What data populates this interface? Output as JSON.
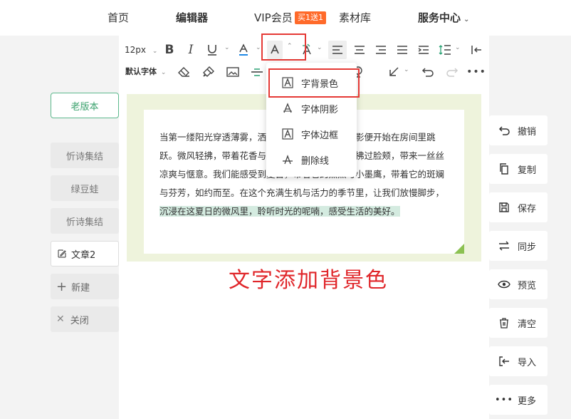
{
  "nav": {
    "home": "首页",
    "editor": "编辑器",
    "vip": "VIP会员",
    "vip_badge": "买1送1",
    "materials": "素材库",
    "service": "服务中心"
  },
  "toolbar": {
    "font_size": "12px",
    "font_family": "默认字体"
  },
  "dropdown": {
    "items": [
      "字背景色",
      "字体阴影",
      "字体边框",
      "删除线"
    ]
  },
  "content": {
    "text_plain": "当第一缕阳光穿透薄雾，洒落在大地上，夏日的光影便开始在房间里跳跃。微风轻拂，带着花香与草香，悄悄溜进窗棂，拂过脸颊，带来一丝丝凉爽与惬意。我们能感受到夏日，带着它的热烈与小墨鹰，带着它的斑斓与芬芳，如约而至。在这个充满生机与活力的季节里，让我们放慢脚步，",
    "text_highlighted": "沉浸在这夏日的微风里，聆听时光的呢喃，感受生活的美好。"
  },
  "caption": "文字添加背景色",
  "left_sidebar": {
    "old_version": "老版本",
    "items": [
      "忻诗集结",
      "绿豆蛙",
      "忻诗集结"
    ],
    "active": "文章2",
    "new": "新建",
    "close": "关闭"
  },
  "right_sidebar": {
    "items": [
      "撤销",
      "复制",
      "保存",
      "同步",
      "预览",
      "清空",
      "导入",
      "更多"
    ]
  },
  "colors": {
    "accent": "#e53935",
    "highlight": "#d4ebe0",
    "canvas_bg": "#eef3dc",
    "brand_green": "#3aa16c"
  }
}
